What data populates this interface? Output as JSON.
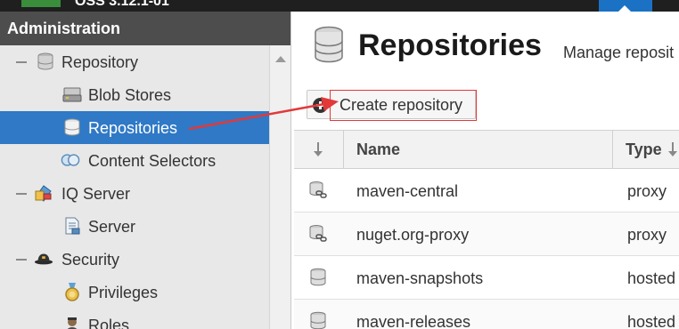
{
  "header": {
    "version": "OSS 3.12.1-01"
  },
  "sidebar": {
    "title": "Administration",
    "items": [
      {
        "label": "Repository",
        "icon": "database-icon",
        "level": 0
      },
      {
        "label": "Blob Stores",
        "icon": "blob-store-icon",
        "level": 1
      },
      {
        "label": "Repositories",
        "icon": "database-icon",
        "level": 1,
        "selected": true
      },
      {
        "label": "Content Selectors",
        "icon": "content-selector-icon",
        "level": 1
      },
      {
        "label": "IQ Server",
        "icon": "iq-server-icon",
        "level": 0
      },
      {
        "label": "Server",
        "icon": "server-doc-icon",
        "level": 1
      },
      {
        "label": "Security",
        "icon": "security-hat-icon",
        "level": 0
      },
      {
        "label": "Privileges",
        "icon": "medal-icon",
        "level": 1
      },
      {
        "label": "Roles",
        "icon": "role-user-icon",
        "level": 1
      }
    ]
  },
  "main": {
    "title": "Repositories",
    "subtitle": "Manage reposit",
    "toolbar": {
      "create_label": "Create repository"
    },
    "table": {
      "columns": [
        "Name",
        "Type"
      ],
      "rows": [
        {
          "name": "maven-central",
          "type": "proxy",
          "icon": "proxy-repo-icon"
        },
        {
          "name": "nuget.org-proxy",
          "type": "proxy",
          "icon": "proxy-repo-icon"
        },
        {
          "name": "maven-snapshots",
          "type": "hosted",
          "icon": "hosted-repo-icon"
        },
        {
          "name": "maven-releases",
          "type": "hosted",
          "icon": "hosted-repo-icon"
        }
      ]
    }
  },
  "colors": {
    "selection": "#2f79c6",
    "sidebar_header": "#4d4d4d",
    "annotation": "#e2393a",
    "topbar": "#1f1f1f"
  }
}
